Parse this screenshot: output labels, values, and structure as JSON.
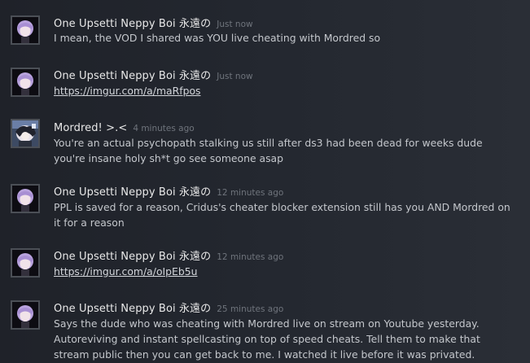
{
  "comments": [
    {
      "author": "One Upsetti Neppy Boi 永遠の",
      "timestamp": "Just now",
      "avatar": "purple-hair-avatar",
      "lines": [
        "I mean, the VOD I shared was YOU live cheating with Mordred so"
      ],
      "link": ""
    },
    {
      "author": "One Upsetti Neppy Boi 永遠の",
      "timestamp": "Just now",
      "avatar": "purple-hair-avatar",
      "lines": [],
      "link": "https://imgur.com/a/maRfpos"
    },
    {
      "author": "Mordred! >.<",
      "timestamp": "4 minutes ago",
      "avatar": "anime-character-avatar",
      "lines": [
        "You're an actual psychopath stalking us still after ds3 had been dead for weeks dude",
        "you're insane holy sh*t go see someone asap"
      ],
      "link": ""
    },
    {
      "author": "One Upsetti Neppy Boi 永遠の",
      "timestamp": "12 minutes ago",
      "avatar": "purple-hair-avatar",
      "lines": [
        "PPL is saved for a reason, Cridus's cheater blocker extension still has you AND Mordred on",
        "it for a reason"
      ],
      "link": ""
    },
    {
      "author": "One Upsetti Neppy Boi 永遠の",
      "timestamp": "12 minutes ago",
      "avatar": "purple-hair-avatar",
      "lines": [],
      "link": "https://imgur.com/a/oIpEb5u"
    },
    {
      "author": "One Upsetti Neppy Boi 永遠の",
      "timestamp": "25 minutes ago",
      "avatar": "purple-hair-avatar",
      "lines": [
        "Says the dude who was cheating with Mordred live on stream on Youtube yesterday.",
        "Autoreviving and instant spellcasting on top of speed cheats. Tell them to make that",
        "stream public then you can get back to me. I watched it live before it was privated."
      ],
      "link": ""
    }
  ],
  "colors": {
    "background": "#23272f",
    "author": "#e8e8e8",
    "timestamp": "#6f747c",
    "text": "#c4c7cc",
    "avatar_border": "#4b4f56"
  }
}
